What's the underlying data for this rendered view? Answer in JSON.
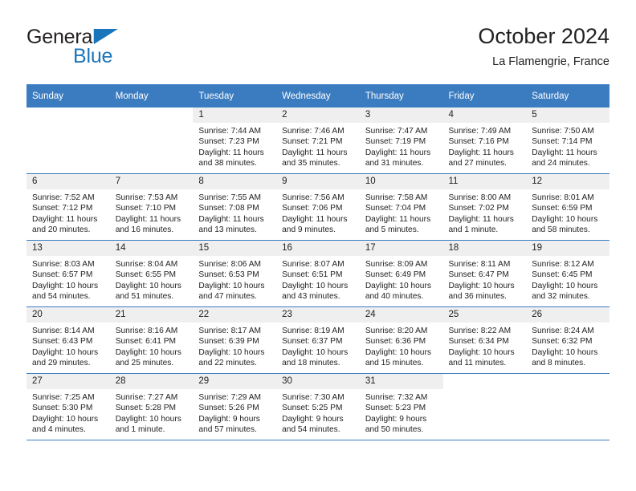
{
  "brand": {
    "name_top": "General",
    "name_bottom": "Blue",
    "triangle_color": "#1b75bb",
    "top_color": "#231f20"
  },
  "header": {
    "title": "October 2024",
    "subtitle": "La Flamengrie, France"
  },
  "colors": {
    "header_blue": "#3b7cc0",
    "daynum_band": "#efefef",
    "text": "#222222"
  },
  "weekdays": [
    "Sunday",
    "Monday",
    "Tuesday",
    "Wednesday",
    "Thursday",
    "Friday",
    "Saturday"
  ],
  "labels": {
    "sunrise_prefix": "Sunrise:",
    "sunset_prefix": "Sunset:",
    "daylight_prefix": "Daylight:"
  },
  "weeks": [
    [
      {
        "day": "",
        "empty": true
      },
      {
        "day": "",
        "empty": true
      },
      {
        "day": "1",
        "sunrise": "Sunrise: 7:44 AM",
        "sunset": "Sunset: 7:23 PM",
        "daylight": "Daylight: 11 hours and 38 minutes."
      },
      {
        "day": "2",
        "sunrise": "Sunrise: 7:46 AM",
        "sunset": "Sunset: 7:21 PM",
        "daylight": "Daylight: 11 hours and 35 minutes."
      },
      {
        "day": "3",
        "sunrise": "Sunrise: 7:47 AM",
        "sunset": "Sunset: 7:19 PM",
        "daylight": "Daylight: 11 hours and 31 minutes."
      },
      {
        "day": "4",
        "sunrise": "Sunrise: 7:49 AM",
        "sunset": "Sunset: 7:16 PM",
        "daylight": "Daylight: 11 hours and 27 minutes."
      },
      {
        "day": "5",
        "sunrise": "Sunrise: 7:50 AM",
        "sunset": "Sunset: 7:14 PM",
        "daylight": "Daylight: 11 hours and 24 minutes."
      }
    ],
    [
      {
        "day": "6",
        "sunrise": "Sunrise: 7:52 AM",
        "sunset": "Sunset: 7:12 PM",
        "daylight": "Daylight: 11 hours and 20 minutes."
      },
      {
        "day": "7",
        "sunrise": "Sunrise: 7:53 AM",
        "sunset": "Sunset: 7:10 PM",
        "daylight": "Daylight: 11 hours and 16 minutes."
      },
      {
        "day": "8",
        "sunrise": "Sunrise: 7:55 AM",
        "sunset": "Sunset: 7:08 PM",
        "daylight": "Daylight: 11 hours and 13 minutes."
      },
      {
        "day": "9",
        "sunrise": "Sunrise: 7:56 AM",
        "sunset": "Sunset: 7:06 PM",
        "daylight": "Daylight: 11 hours and 9 minutes."
      },
      {
        "day": "10",
        "sunrise": "Sunrise: 7:58 AM",
        "sunset": "Sunset: 7:04 PM",
        "daylight": "Daylight: 11 hours and 5 minutes."
      },
      {
        "day": "11",
        "sunrise": "Sunrise: 8:00 AM",
        "sunset": "Sunset: 7:02 PM",
        "daylight": "Daylight: 11 hours and 1 minute."
      },
      {
        "day": "12",
        "sunrise": "Sunrise: 8:01 AM",
        "sunset": "Sunset: 6:59 PM",
        "daylight": "Daylight: 10 hours and 58 minutes."
      }
    ],
    [
      {
        "day": "13",
        "sunrise": "Sunrise: 8:03 AM",
        "sunset": "Sunset: 6:57 PM",
        "daylight": "Daylight: 10 hours and 54 minutes."
      },
      {
        "day": "14",
        "sunrise": "Sunrise: 8:04 AM",
        "sunset": "Sunset: 6:55 PM",
        "daylight": "Daylight: 10 hours and 51 minutes."
      },
      {
        "day": "15",
        "sunrise": "Sunrise: 8:06 AM",
        "sunset": "Sunset: 6:53 PM",
        "daylight": "Daylight: 10 hours and 47 minutes."
      },
      {
        "day": "16",
        "sunrise": "Sunrise: 8:07 AM",
        "sunset": "Sunset: 6:51 PM",
        "daylight": "Daylight: 10 hours and 43 minutes."
      },
      {
        "day": "17",
        "sunrise": "Sunrise: 8:09 AM",
        "sunset": "Sunset: 6:49 PM",
        "daylight": "Daylight: 10 hours and 40 minutes."
      },
      {
        "day": "18",
        "sunrise": "Sunrise: 8:11 AM",
        "sunset": "Sunset: 6:47 PM",
        "daylight": "Daylight: 10 hours and 36 minutes."
      },
      {
        "day": "19",
        "sunrise": "Sunrise: 8:12 AM",
        "sunset": "Sunset: 6:45 PM",
        "daylight": "Daylight: 10 hours and 32 minutes."
      }
    ],
    [
      {
        "day": "20",
        "sunrise": "Sunrise: 8:14 AM",
        "sunset": "Sunset: 6:43 PM",
        "daylight": "Daylight: 10 hours and 29 minutes."
      },
      {
        "day": "21",
        "sunrise": "Sunrise: 8:16 AM",
        "sunset": "Sunset: 6:41 PM",
        "daylight": "Daylight: 10 hours and 25 minutes."
      },
      {
        "day": "22",
        "sunrise": "Sunrise: 8:17 AM",
        "sunset": "Sunset: 6:39 PM",
        "daylight": "Daylight: 10 hours and 22 minutes."
      },
      {
        "day": "23",
        "sunrise": "Sunrise: 8:19 AM",
        "sunset": "Sunset: 6:37 PM",
        "daylight": "Daylight: 10 hours and 18 minutes."
      },
      {
        "day": "24",
        "sunrise": "Sunrise: 8:20 AM",
        "sunset": "Sunset: 6:36 PM",
        "daylight": "Daylight: 10 hours and 15 minutes."
      },
      {
        "day": "25",
        "sunrise": "Sunrise: 8:22 AM",
        "sunset": "Sunset: 6:34 PM",
        "daylight": "Daylight: 10 hours and 11 minutes."
      },
      {
        "day": "26",
        "sunrise": "Sunrise: 8:24 AM",
        "sunset": "Sunset: 6:32 PM",
        "daylight": "Daylight: 10 hours and 8 minutes."
      }
    ],
    [
      {
        "day": "27",
        "sunrise": "Sunrise: 7:25 AM",
        "sunset": "Sunset: 5:30 PM",
        "daylight": "Daylight: 10 hours and 4 minutes."
      },
      {
        "day": "28",
        "sunrise": "Sunrise: 7:27 AM",
        "sunset": "Sunset: 5:28 PM",
        "daylight": "Daylight: 10 hours and 1 minute."
      },
      {
        "day": "29",
        "sunrise": "Sunrise: 7:29 AM",
        "sunset": "Sunset: 5:26 PM",
        "daylight": "Daylight: 9 hours and 57 minutes."
      },
      {
        "day": "30",
        "sunrise": "Sunrise: 7:30 AM",
        "sunset": "Sunset: 5:25 PM",
        "daylight": "Daylight: 9 hours and 54 minutes."
      },
      {
        "day": "31",
        "sunrise": "Sunrise: 7:32 AM",
        "sunset": "Sunset: 5:23 PM",
        "daylight": "Daylight: 9 hours and 50 minutes."
      },
      {
        "day": "",
        "empty": true
      },
      {
        "day": "",
        "empty": true
      }
    ]
  ]
}
